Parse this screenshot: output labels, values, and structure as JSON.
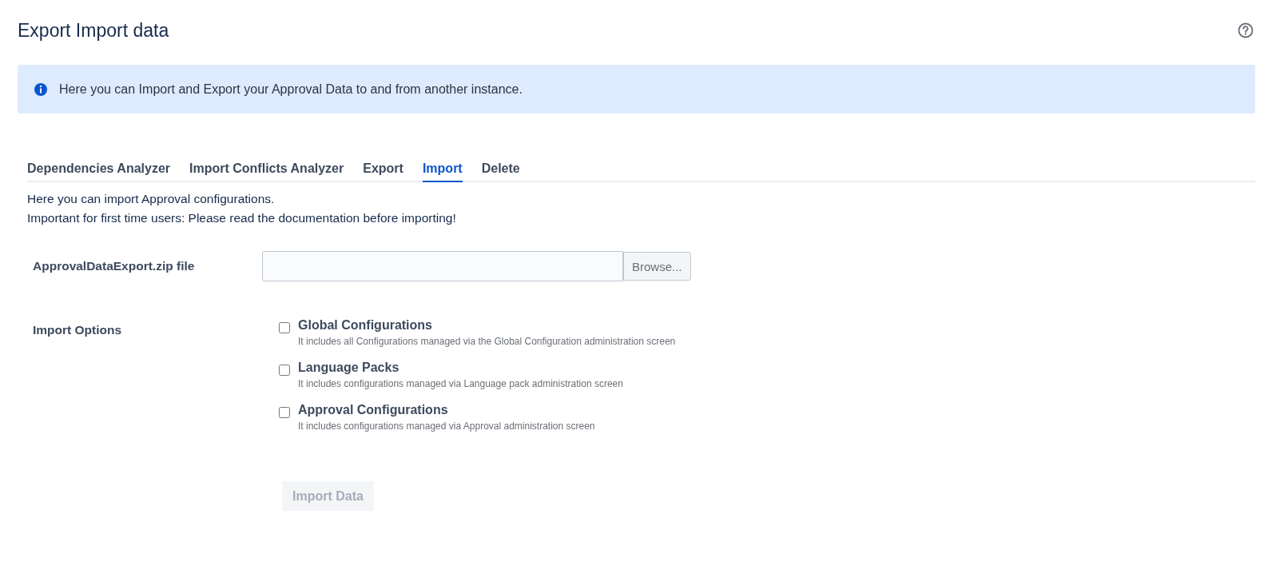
{
  "page": {
    "title": "Export Import data"
  },
  "info_banner": {
    "text": "Here you can Import and Export your Approval Data to and from another instance."
  },
  "tabs": [
    {
      "label": "Dependencies Analyzer",
      "selected": false
    },
    {
      "label": "Import Conflicts Analyzer",
      "selected": false
    },
    {
      "label": "Export",
      "selected": false
    },
    {
      "label": "Import",
      "selected": true
    },
    {
      "label": "Delete",
      "selected": false
    }
  ],
  "description": [
    "Here you can import Approval configurations.",
    "Important for first time users: Please read the documentation before importing!"
  ],
  "file_field": {
    "label": "ApprovalDataExport.zip file",
    "button": "Browse..."
  },
  "import_options": {
    "label": "Import Options",
    "options": [
      {
        "label": "Global Configurations",
        "hint": "It includes all Configurations managed via the Global Configuration administration screen",
        "checked": false
      },
      {
        "label": "Language Packs",
        "hint": "It includes configurations managed via Language pack administration screen",
        "checked": false
      },
      {
        "label": "Approval Configurations",
        "hint": "It includes configurations managed via Approval administration screen",
        "checked": false
      }
    ]
  },
  "submit": {
    "label": "Import Data",
    "disabled": true
  }
}
